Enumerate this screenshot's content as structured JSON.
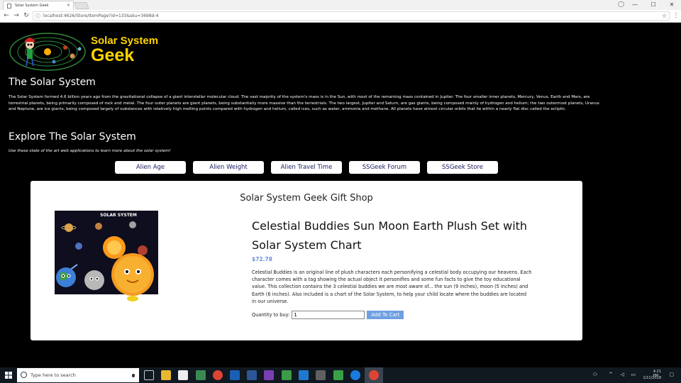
{
  "browser": {
    "tab_title": "Solar System Geek",
    "tab_close": "×",
    "url": "localhost:4626/Store/ItemPage?id=133&sku=3698d-4",
    "win_min": "—",
    "win_max": "☐",
    "win_close": "✕"
  },
  "header": {
    "brand_line1": "Solar System",
    "brand_line2": "Geek"
  },
  "intro": {
    "heading": "The Solar System",
    "paragraph": "The Solar System formed 4.6 billion years ago from the gravitational collapse of a giant interstellar molecular cloud. The vast majority of the system's mass is in the Sun, with most of the remaining mass contained in Jupiter. The four smaller inner planets, Mercury, Venus, Earth and Mars, are terrestrial planets, being primarily composed of rock and metal. The four outer planets are giant planets, being substantially more massive than the terrestrials. The two largest, Jupiter and Saturn, are gas giants, being composed mainly of hydrogen and helium; the two outermost planets, Uranus and Neptune, are ice giants, being composed largely of substances with relatively high melting points compared with hydrogen and helium, called ices, such as water, ammonia and methane. All planets have almost circular orbits that lie within a nearly flat disc called the ecliptic."
  },
  "explore": {
    "heading": "Explore The Solar System",
    "subtext": "Use these state of the art web applications to learn more about the solar system!"
  },
  "nav_buttons": [
    "Alien Age",
    "Alien Weight",
    "Alien Travel Time",
    "SSGeek Forum",
    "SSGeek Store"
  ],
  "store": {
    "title": "Solar System Geek Gift Shop",
    "product_name": "Celestial Buddies Sun Moon Earth Plush Set with Solar System Chart",
    "price": "$72.78",
    "description": "Celestial Buddies is an original line of plush characters each personifying a celestial body occupying our heavens. Each character comes with a tag showing the actual object it personifies and some fun facts to give the toy educational value. This collection contains the 3 celestial buddies we are most aware of... the sun (9 inches), moon (5 inches) and Earth (6 inches). Also included is a chart of the Solar System, to help your child locate where the buddies are located in our universe.",
    "qty_label": "Quantity to buy:",
    "qty_value": "1",
    "add_to_cart": "Add To Cart",
    "chart_label": "SOLAR SYSTEM"
  },
  "taskbar": {
    "search_placeholder": "Type here to search",
    "time": "4:21 PM",
    "date": "1/11/2018"
  },
  "colors": {
    "brand_yellow": "#ffd400",
    "price_blue": "#6b8fd8",
    "button_blue": "#6e9fe0"
  }
}
